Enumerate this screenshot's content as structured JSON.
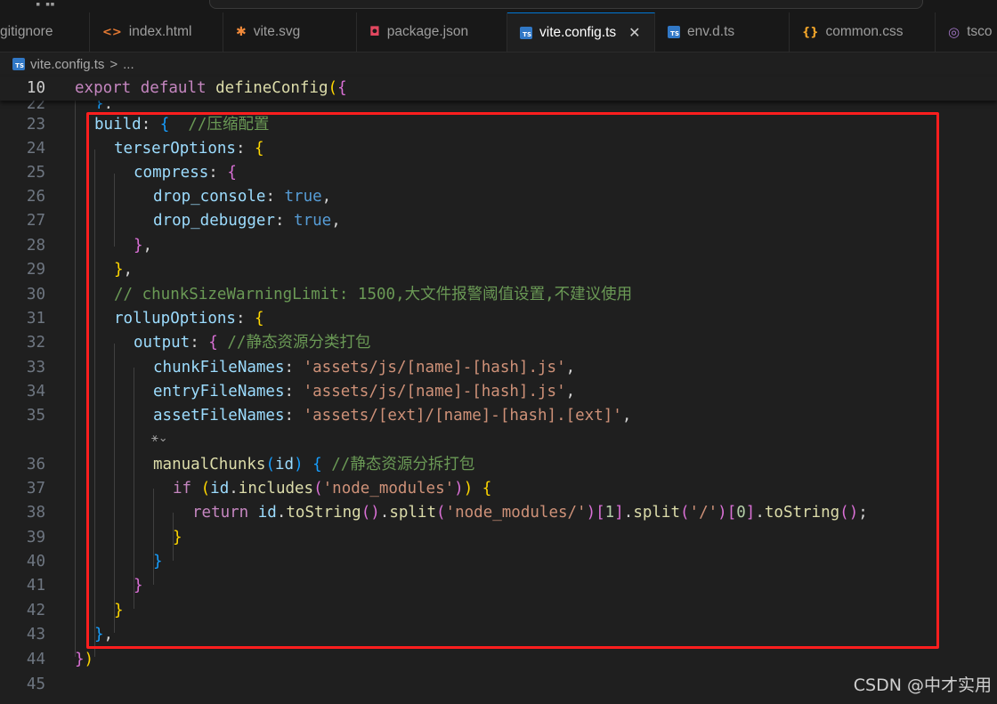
{
  "tabs": [
    {
      "label": "gitignore",
      "icon": "gitignore-icon",
      "glyph": ""
    },
    {
      "label": "index.html",
      "icon": "html-icon",
      "glyph": "<>"
    },
    {
      "label": "vite.svg",
      "icon": "svg-icon",
      "glyph": "✱"
    },
    {
      "label": "package.json",
      "icon": "json-icon",
      "glyph": "◘"
    },
    {
      "label": "vite.config.ts",
      "icon": "typescript-icon",
      "glyph": "TS"
    },
    {
      "label": "env.d.ts",
      "icon": "typescript-icon",
      "glyph": "TS"
    },
    {
      "label": "common.css",
      "icon": "css-icon",
      "glyph": "{}"
    },
    {
      "label": "tsco",
      "icon": "tsconfig-icon",
      "glyph": "◎"
    }
  ],
  "active_tab_close": "✕",
  "breadcrumb": {
    "file": "vite.config.ts",
    "separator": ">",
    "more": "..."
  },
  "sticky_line": {
    "number": "10",
    "text": "export default defineConfig({"
  },
  "partial_line": {
    "number": "22",
    "text": "},"
  },
  "lines": [
    {
      "n": "23",
      "text": "build: {  //压缩配置"
    },
    {
      "n": "24",
      "text": "terserOptions: {"
    },
    {
      "n": "25",
      "text": "compress: {"
    },
    {
      "n": "26",
      "text": "drop_console: true,"
    },
    {
      "n": "27",
      "text": "drop_debugger: true,"
    },
    {
      "n": "28",
      "text": "},"
    },
    {
      "n": "29",
      "text": "},"
    },
    {
      "n": "30",
      "text": "// chunkSizeWarningLimit: 1500,大文件报警阈值设置,不建议使用"
    },
    {
      "n": "31",
      "text": "rollupOptions: {"
    },
    {
      "n": "32",
      "text": "output: { //静态资源分类打包"
    },
    {
      "n": "33",
      "text": "chunkFileNames: 'assets/js/[name]-[hash].js',"
    },
    {
      "n": "34",
      "text": "entryFileNames: 'assets/js/[name]-[hash].js',"
    },
    {
      "n": "35",
      "text": "assetFileNames: 'assets/[ext]/[name]-[hash].[ext]',"
    },
    {
      "n": "36",
      "text": "manualChunks(id) { //静态资源分拆打包"
    },
    {
      "n": "37",
      "text": "if (id.includes('node_modules')) {"
    },
    {
      "n": "38",
      "text": "return id.toString().split('node_modules/')[1].split('/')[0].toString();"
    },
    {
      "n": "39",
      "text": "}"
    },
    {
      "n": "40",
      "text": "}"
    },
    {
      "n": "41",
      "text": "}"
    },
    {
      "n": "42",
      "text": "}"
    },
    {
      "n": "43",
      "text": "},"
    },
    {
      "n": "44",
      "text": "})"
    },
    {
      "n": "45",
      "text": ""
    }
  ],
  "code_lens": "⚹⌄",
  "watermark": "CSDN @中才实用",
  "colors": {
    "highlight_box": "#ff1e1e",
    "editor_bg": "#1f1f1f",
    "active_tab_border": "#0078d4"
  }
}
